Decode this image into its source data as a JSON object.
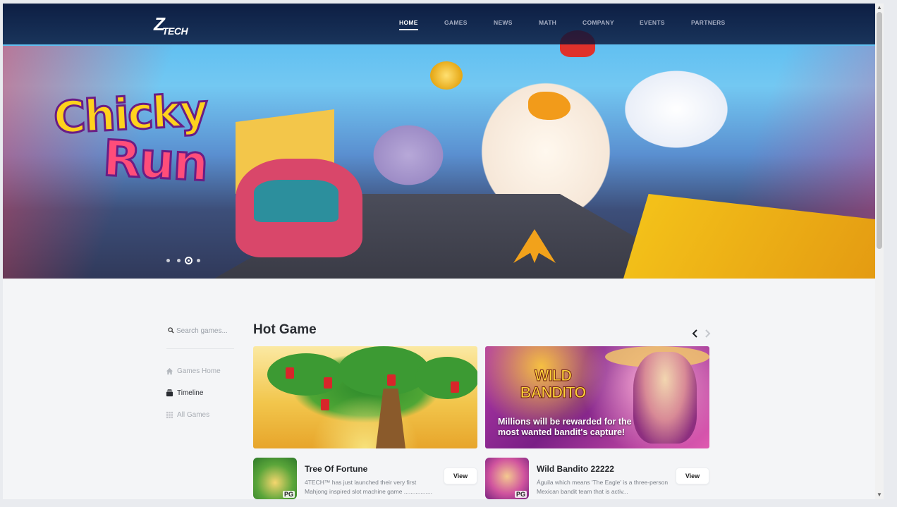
{
  "brand": {
    "logo_mark": "Z",
    "logo_word": "TECH"
  },
  "nav": {
    "items": [
      {
        "label": "HOME",
        "active": true
      },
      {
        "label": "GAMES",
        "active": false
      },
      {
        "label": "NEWS",
        "active": false
      },
      {
        "label": "MATH",
        "active": false
      },
      {
        "label": "COMPANY",
        "active": false
      },
      {
        "label": "EVENTS",
        "active": false
      },
      {
        "label": "PARTNERS",
        "active": false
      }
    ]
  },
  "hero": {
    "title_line1": "Chicky",
    "title_line2": "Run",
    "slides_count": 4,
    "active_slide": 3
  },
  "sidebar": {
    "search": {
      "placeholder": "Search games..."
    },
    "items": [
      {
        "label": "Games Home",
        "icon": "home-icon",
        "active": false
      },
      {
        "label": "Timeline",
        "icon": "timeline-icon",
        "active": true
      },
      {
        "label": "All Games",
        "icon": "grid-icon",
        "active": false
      }
    ]
  },
  "hot_game": {
    "title": "Hot Game",
    "prev_icon": "chevron-left-icon",
    "next_icon": "chevron-right-icon",
    "cards": [
      {
        "name": "Tree Of Fortune",
        "description": "4TECH™ has just launched their very first Mahjong inspired slot machine game .................",
        "view_label": "View",
        "thumb_badge": "PG"
      },
      {
        "name": "Wild Bandito 22222",
        "description": "Águila which means 'The Eagle' is a three-person Mexican bandit team that is activ...",
        "view_label": "View",
        "thumb_badge": "PG",
        "banner_logo": "WILD BANDITO",
        "banner_tagline": "Millions will be rewarded for the most wanted bandit's capture!"
      }
    ]
  },
  "colors": {
    "nav_bg": "#0a163a",
    "page_bg": "#f4f5f7",
    "title_text": "#2b2e33",
    "muted_text": "#a7acb3"
  }
}
